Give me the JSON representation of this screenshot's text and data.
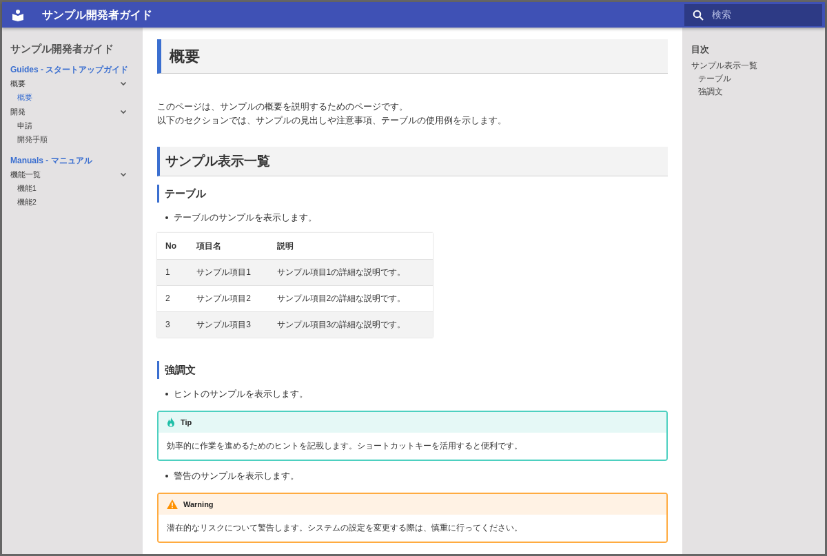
{
  "header": {
    "title": "サンプル開発者ガイド",
    "search": {
      "placeholder": "検索"
    }
  },
  "sidebar": {
    "title": "サンプル開発者ガイド",
    "sections": [
      {
        "caption": "Guides - スタートアップガイド",
        "items": [
          {
            "label": "概要",
            "expanded": true,
            "children": [
              {
                "label": "概要",
                "selected": true
              }
            ]
          },
          {
            "label": "開発",
            "expanded": true,
            "children": [
              {
                "label": "申請",
                "selected": false
              },
              {
                "label": "開発手順",
                "selected": false
              }
            ]
          }
        ]
      },
      {
        "caption": "Manuals - マニュアル",
        "items": [
          {
            "label": "機能一覧",
            "expanded": true,
            "children": [
              {
                "label": "機能1",
                "selected": false
              },
              {
                "label": "機能2",
                "selected": false
              }
            ]
          }
        ]
      }
    ]
  },
  "content": [
    {
      "kind": "h1",
      "text": "概要"
    },
    {
      "kind": "paragraph",
      "lines": [
        "このページは、サンプルの概要を説明するためのページです。",
        "以下のセクションでは、サンプルの見出しや注意事項、テーブルの使用例を示します。"
      ]
    },
    {
      "kind": "h2",
      "text": "サンプル表示一覧"
    },
    {
      "kind": "h3",
      "text": "テーブル"
    },
    {
      "kind": "bullet",
      "text": "テーブルのサンプルを表示します。"
    },
    {
      "kind": "table",
      "columns": [
        "No",
        "項目名",
        "説明"
      ],
      "rows": [
        [
          "1",
          "サンプル項目1",
          "サンプル項目1の詳細な説明です。"
        ],
        [
          "2",
          "サンプル項目2",
          "サンプル項目2の詳細な説明です。"
        ],
        [
          "3",
          "サンプル項目3",
          "サンプル項目3の詳細な説明です。"
        ]
      ]
    },
    {
      "kind": "h3",
      "text": "強調文"
    },
    {
      "kind": "bullet",
      "text": "ヒントのサンプルを表示します。"
    },
    {
      "kind": "tip",
      "title": "Tip",
      "text": "効率的に作業を進めるためのヒントを記載します。ショートカットキーを活用すると便利です。"
    },
    {
      "kind": "bullet",
      "text": "警告のサンプルを表示します。"
    },
    {
      "kind": "warning",
      "title": "Warning",
      "text": "潜在的なリスクについて警告します。システムの設定を変更する際は、慎重に行ってください。"
    }
  ],
  "toc": {
    "title": "目次",
    "items": [
      {
        "label": "サンプル表示一覧",
        "children": [
          {
            "label": "テーブル"
          },
          {
            "label": "強調文"
          }
        ]
      }
    ]
  }
}
